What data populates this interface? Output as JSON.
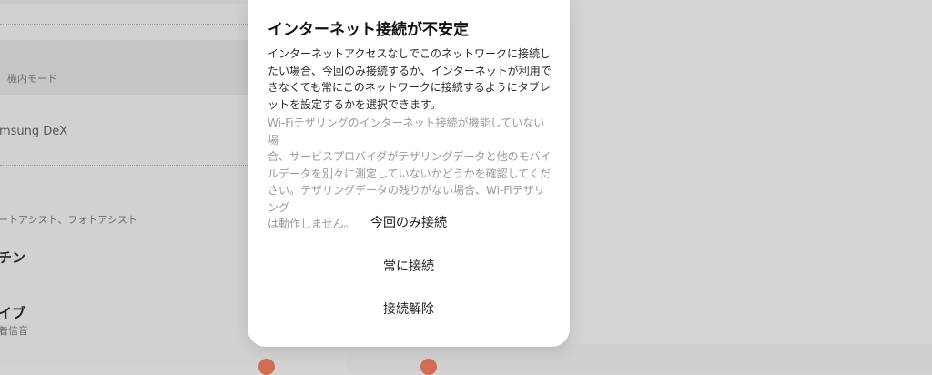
{
  "background": {
    "airplane_mode": "機内モード",
    "dex": "msung DeX",
    "assist": "ートアシスト、フォトアシスト",
    "routine": "チン",
    "vibe": "イブ",
    "vibe_sub": "着信音"
  },
  "dialog": {
    "title": "インターネット接続が不安定",
    "body_primary": "インターネットアクセスなしでこのネットワークに接続し\nたい場合、今回のみ接続するか、インターネットが利用で\nきなくても常にこのネットワークに接続するようにタブレ\nットを設定するかを選択できます。",
    "body_secondary": "Wi-Fiテザリングのインターネット接続が機能していない場\n合、サービスプロバイダがテザリングデータと他のモバイ\nルデータを別々に測定していないかどうかを確認してくだ\nさい。テザリングデータの残りがない場合、Wi-Fiテザリング\nは動作しません。",
    "actions": {
      "connect_once": "今回のみ接続",
      "always_connect": "常に接続",
      "disconnect": "接続解除"
    }
  },
  "colors": {
    "background_dim": "#d1d1d1",
    "dialog_bg": "#ffffff",
    "primary_text": "#111111",
    "secondary_text": "#9a9a9a",
    "accent": "#d66b52"
  }
}
